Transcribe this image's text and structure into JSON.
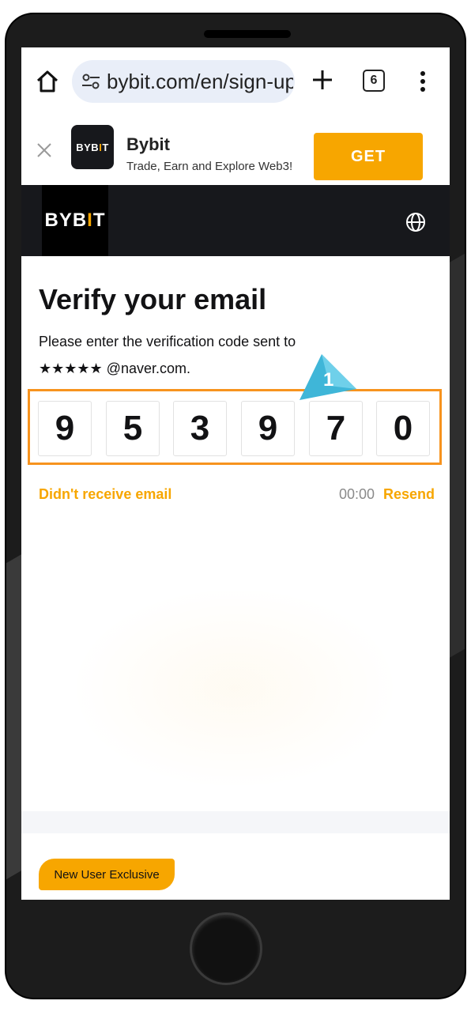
{
  "browser": {
    "url": "bybit.com/en/sign-up",
    "tab_count": "6"
  },
  "app_banner": {
    "logo_text_a": "BYB",
    "logo_text_tick": "I",
    "logo_text_b": "T",
    "name": "Bybit",
    "subtitle": "Trade, Earn and Explore Web3!",
    "get_label": "GET"
  },
  "site_header": {
    "logo_text_a": "BYB",
    "logo_text_tick": "I",
    "logo_text_b": "T"
  },
  "verify": {
    "title": "Verify your email",
    "instruction": "Please enter the verification code sent to",
    "email": "★★★★★ @naver.com.",
    "code": [
      "9",
      "5",
      "3",
      "9",
      "7",
      "0"
    ],
    "callout_number": "1",
    "didnt_receive_label": "Didn't receive email",
    "timer": "00:00",
    "resend_label": "Resend"
  },
  "promo": {
    "label": "New User Exclusive"
  },
  "colors": {
    "brand_orange": "#f7a600",
    "highlight_orange": "#f7931e",
    "callout_blue": "#3fb6d8",
    "header_dark": "#17181c"
  }
}
